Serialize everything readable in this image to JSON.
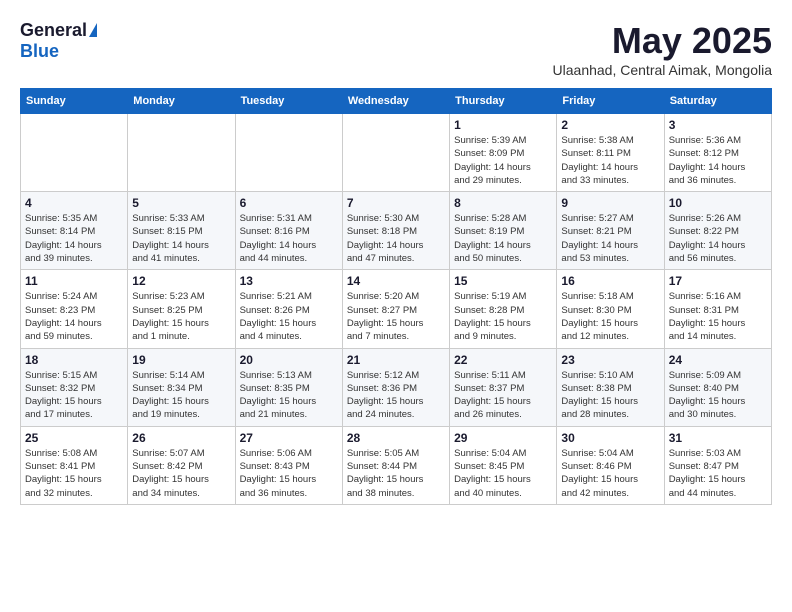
{
  "logo": {
    "general": "General",
    "blue": "Blue"
  },
  "title": "May 2025",
  "subtitle": "Ulaanhad, Central Aimak, Mongolia",
  "days_of_week": [
    "Sunday",
    "Monday",
    "Tuesday",
    "Wednesday",
    "Thursday",
    "Friday",
    "Saturday"
  ],
  "weeks": [
    [
      {
        "day": "",
        "info": ""
      },
      {
        "day": "",
        "info": ""
      },
      {
        "day": "",
        "info": ""
      },
      {
        "day": "",
        "info": ""
      },
      {
        "day": "1",
        "info": "Sunrise: 5:39 AM\nSunset: 8:09 PM\nDaylight: 14 hours\nand 29 minutes."
      },
      {
        "day": "2",
        "info": "Sunrise: 5:38 AM\nSunset: 8:11 PM\nDaylight: 14 hours\nand 33 minutes."
      },
      {
        "day": "3",
        "info": "Sunrise: 5:36 AM\nSunset: 8:12 PM\nDaylight: 14 hours\nand 36 minutes."
      }
    ],
    [
      {
        "day": "4",
        "info": "Sunrise: 5:35 AM\nSunset: 8:14 PM\nDaylight: 14 hours\nand 39 minutes."
      },
      {
        "day": "5",
        "info": "Sunrise: 5:33 AM\nSunset: 8:15 PM\nDaylight: 14 hours\nand 41 minutes."
      },
      {
        "day": "6",
        "info": "Sunrise: 5:31 AM\nSunset: 8:16 PM\nDaylight: 14 hours\nand 44 minutes."
      },
      {
        "day": "7",
        "info": "Sunrise: 5:30 AM\nSunset: 8:18 PM\nDaylight: 14 hours\nand 47 minutes."
      },
      {
        "day": "8",
        "info": "Sunrise: 5:28 AM\nSunset: 8:19 PM\nDaylight: 14 hours\nand 50 minutes."
      },
      {
        "day": "9",
        "info": "Sunrise: 5:27 AM\nSunset: 8:21 PM\nDaylight: 14 hours\nand 53 minutes."
      },
      {
        "day": "10",
        "info": "Sunrise: 5:26 AM\nSunset: 8:22 PM\nDaylight: 14 hours\nand 56 minutes."
      }
    ],
    [
      {
        "day": "11",
        "info": "Sunrise: 5:24 AM\nSunset: 8:23 PM\nDaylight: 14 hours\nand 59 minutes."
      },
      {
        "day": "12",
        "info": "Sunrise: 5:23 AM\nSunset: 8:25 PM\nDaylight: 15 hours\nand 1 minute."
      },
      {
        "day": "13",
        "info": "Sunrise: 5:21 AM\nSunset: 8:26 PM\nDaylight: 15 hours\nand 4 minutes."
      },
      {
        "day": "14",
        "info": "Sunrise: 5:20 AM\nSunset: 8:27 PM\nDaylight: 15 hours\nand 7 minutes."
      },
      {
        "day": "15",
        "info": "Sunrise: 5:19 AM\nSunset: 8:28 PM\nDaylight: 15 hours\nand 9 minutes."
      },
      {
        "day": "16",
        "info": "Sunrise: 5:18 AM\nSunset: 8:30 PM\nDaylight: 15 hours\nand 12 minutes."
      },
      {
        "day": "17",
        "info": "Sunrise: 5:16 AM\nSunset: 8:31 PM\nDaylight: 15 hours\nand 14 minutes."
      }
    ],
    [
      {
        "day": "18",
        "info": "Sunrise: 5:15 AM\nSunset: 8:32 PM\nDaylight: 15 hours\nand 17 minutes."
      },
      {
        "day": "19",
        "info": "Sunrise: 5:14 AM\nSunset: 8:34 PM\nDaylight: 15 hours\nand 19 minutes."
      },
      {
        "day": "20",
        "info": "Sunrise: 5:13 AM\nSunset: 8:35 PM\nDaylight: 15 hours\nand 21 minutes."
      },
      {
        "day": "21",
        "info": "Sunrise: 5:12 AM\nSunset: 8:36 PM\nDaylight: 15 hours\nand 24 minutes."
      },
      {
        "day": "22",
        "info": "Sunrise: 5:11 AM\nSunset: 8:37 PM\nDaylight: 15 hours\nand 26 minutes."
      },
      {
        "day": "23",
        "info": "Sunrise: 5:10 AM\nSunset: 8:38 PM\nDaylight: 15 hours\nand 28 minutes."
      },
      {
        "day": "24",
        "info": "Sunrise: 5:09 AM\nSunset: 8:40 PM\nDaylight: 15 hours\nand 30 minutes."
      }
    ],
    [
      {
        "day": "25",
        "info": "Sunrise: 5:08 AM\nSunset: 8:41 PM\nDaylight: 15 hours\nand 32 minutes."
      },
      {
        "day": "26",
        "info": "Sunrise: 5:07 AM\nSunset: 8:42 PM\nDaylight: 15 hours\nand 34 minutes."
      },
      {
        "day": "27",
        "info": "Sunrise: 5:06 AM\nSunset: 8:43 PM\nDaylight: 15 hours\nand 36 minutes."
      },
      {
        "day": "28",
        "info": "Sunrise: 5:05 AM\nSunset: 8:44 PM\nDaylight: 15 hours\nand 38 minutes."
      },
      {
        "day": "29",
        "info": "Sunrise: 5:04 AM\nSunset: 8:45 PM\nDaylight: 15 hours\nand 40 minutes."
      },
      {
        "day": "30",
        "info": "Sunrise: 5:04 AM\nSunset: 8:46 PM\nDaylight: 15 hours\nand 42 minutes."
      },
      {
        "day": "31",
        "info": "Sunrise: 5:03 AM\nSunset: 8:47 PM\nDaylight: 15 hours\nand 44 minutes."
      }
    ]
  ]
}
